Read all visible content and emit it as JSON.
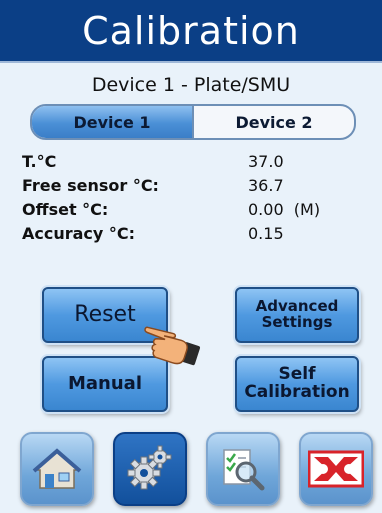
{
  "header": {
    "title": "Calibration"
  },
  "device_title": "Device 1 - Plate/SMU",
  "tabs": [
    {
      "label": "Device 1",
      "active": true
    },
    {
      "label": "Device 2",
      "active": false
    }
  ],
  "readings": [
    {
      "label": "T.°C",
      "value": "37.0"
    },
    {
      "label": "Free sensor °C:",
      "value": "36.7"
    },
    {
      "label": "Offset °C:",
      "value": "0.00  (M)"
    },
    {
      "label": "Accuracy °C:",
      "value": "0.15"
    }
  ],
  "buttons": {
    "reset": "Reset",
    "advanced_line1": "Advanced",
    "advanced_line2": "Settings",
    "manual": "Manual",
    "self_line1": "Self",
    "self_line2": "Calibration"
  },
  "nav": [
    {
      "icon": "home-icon",
      "active": false
    },
    {
      "icon": "gears-icon",
      "active": true
    },
    {
      "icon": "checklist-search-icon",
      "active": false
    },
    {
      "icon": "logo-icon",
      "active": false
    }
  ],
  "colors": {
    "header": "#0b3f86",
    "background": "#e9f2fa",
    "button": "#4f99e0",
    "logo_red": "#d8232a"
  }
}
